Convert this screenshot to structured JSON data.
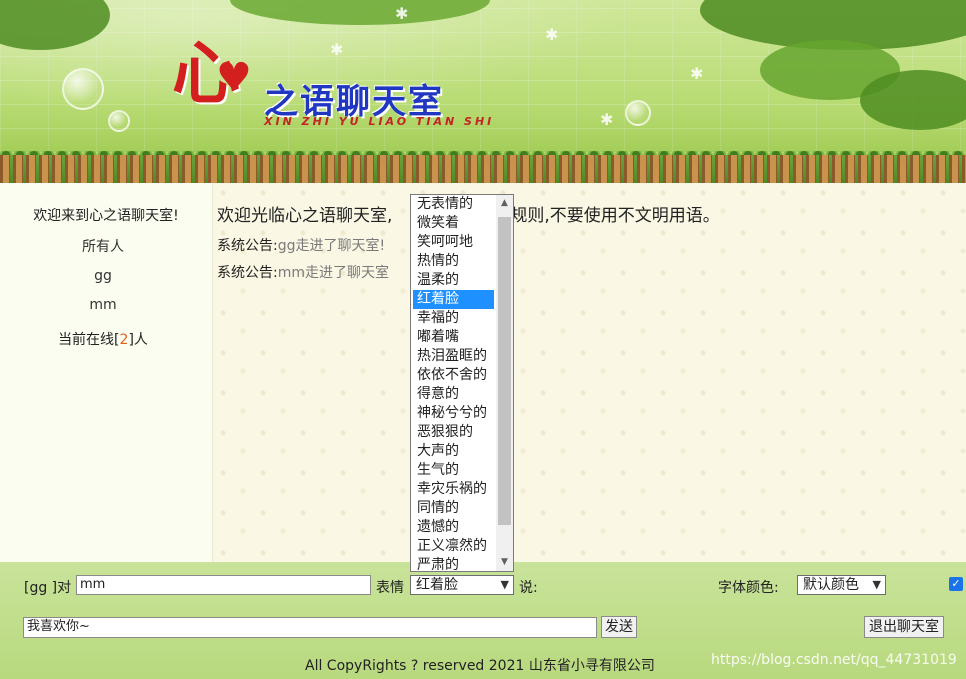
{
  "header": {
    "logo_big_char": "心",
    "logo_title_rest": "之语聊天室",
    "logo_pinyin": "XIN ZHI YU LIAO TIAN SHI"
  },
  "sidebar": {
    "welcome": "欢迎来到心之语聊天室!",
    "users": [
      "所有人",
      "gg",
      "mm"
    ],
    "online_prefix": "当前在线[",
    "online_count": "2",
    "online_suffix": "]人"
  },
  "chat": {
    "welcome_part1": "欢迎光临心之语聊天室,",
    "welcome_part2": "规则,不要使用不文明用语。",
    "notices": [
      {
        "label": "系统公告:",
        "text": "gg走进了聊天室!"
      },
      {
        "label": "系统公告:",
        "text": "mm走进了聊天室"
      }
    ]
  },
  "mood_dropdown": {
    "options": [
      "无表情的",
      "微笑着",
      "笑呵呵地",
      "热情的",
      "温柔的",
      "红着脸",
      "幸福的",
      "嘟着嘴",
      "热泪盈眶的",
      "依依不舍的",
      "得意的",
      "神秘兮兮的",
      "恶狠狠的",
      "大声的",
      "生气的",
      "幸灾乐祸的",
      "同情的",
      "遗憾的",
      "正义凛然的",
      "严肃的"
    ],
    "selected": "红着脸"
  },
  "composer": {
    "from_label": "[gg ]对",
    "to_value": "mm",
    "expression_label": "表情",
    "expression_value": "红着脸",
    "say_label": "说:",
    "font_color_label": "字体颜色:",
    "font_color_value": "默认颜色",
    "message_value": "我喜欢你~",
    "send_label": "发送",
    "exit_label": "退出聊天室"
  },
  "footer": {
    "copyright": "All CopyRights ? reserved 2021 山东省小寻有限公司",
    "watermark": "https://blog.csdn.net/qq_44731019"
  }
}
